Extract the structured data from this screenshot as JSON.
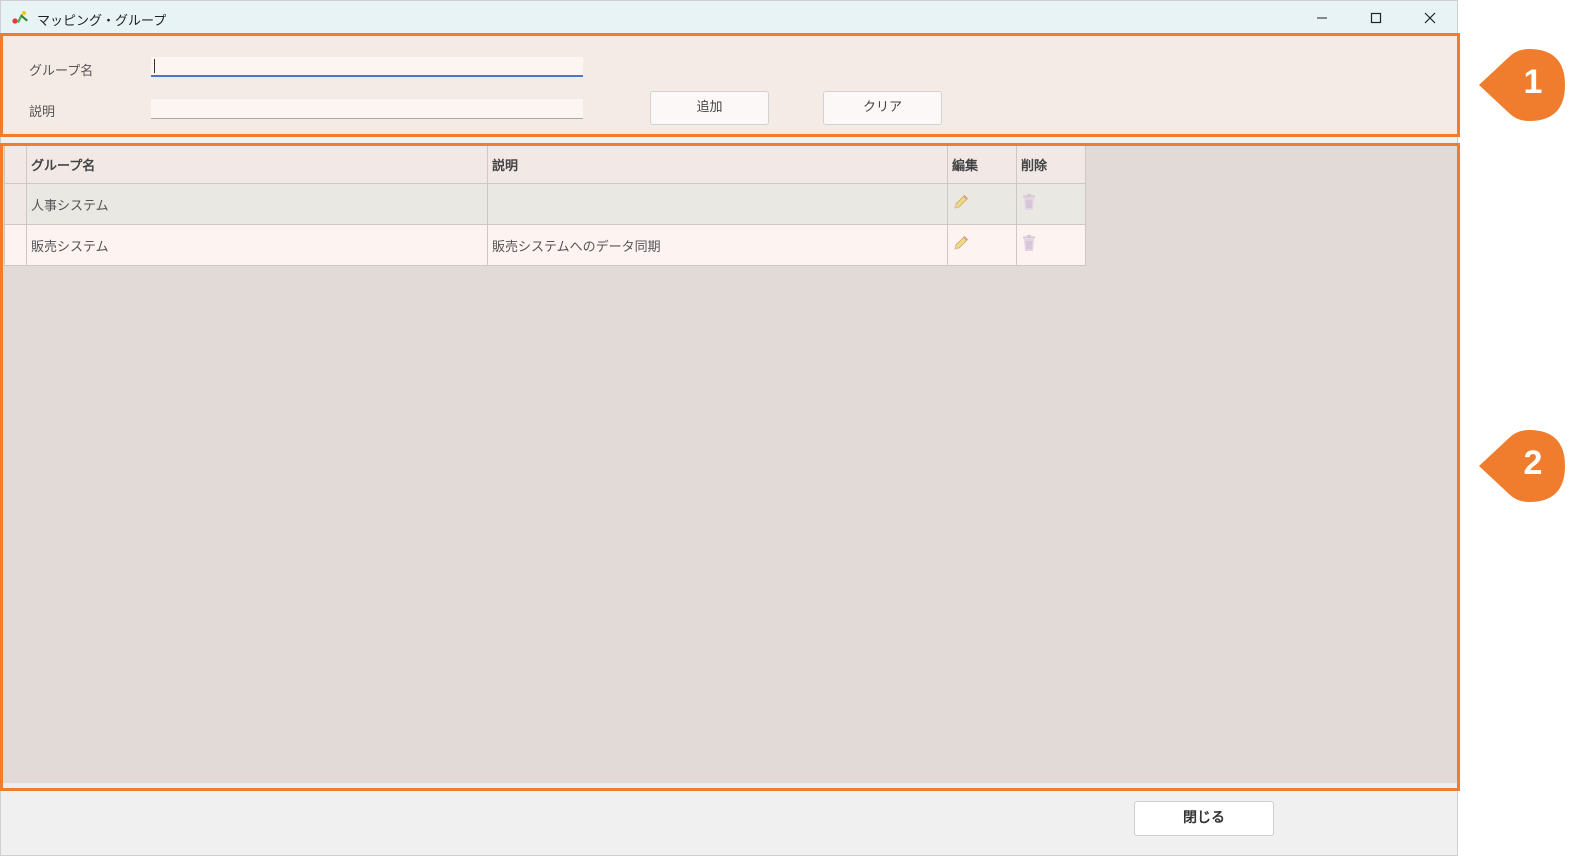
{
  "window": {
    "title": "マッピング・グループ",
    "minimize_icon": "minimize-icon",
    "maximize_icon": "maximize-icon",
    "close_icon": "close-icon"
  },
  "form": {
    "group_name_label": "グループ名",
    "group_name_value": "",
    "description_label": "説明",
    "description_value": "",
    "add_button": "追加",
    "clear_button": "クリア"
  },
  "grid": {
    "columns": [
      "",
      "グループ名",
      "説明",
      "編集",
      "削除"
    ],
    "rows": [
      {
        "name": "人事システム",
        "description": "",
        "edit_icon": "pencil-icon",
        "delete_icon": "trash-icon"
      },
      {
        "name": "販売システム",
        "description": "販売システムへのデータ同期",
        "edit_icon": "pencil-icon",
        "delete_icon": "trash-icon"
      }
    ]
  },
  "footer": {
    "close_button": "閉じる"
  },
  "callouts": [
    "1",
    "2"
  ],
  "colors": {
    "accent": "#ef7d2d",
    "form_bg": "#f5ebe6",
    "grid_bg": "#e2dad6",
    "input_focus": "#4a78c8"
  }
}
